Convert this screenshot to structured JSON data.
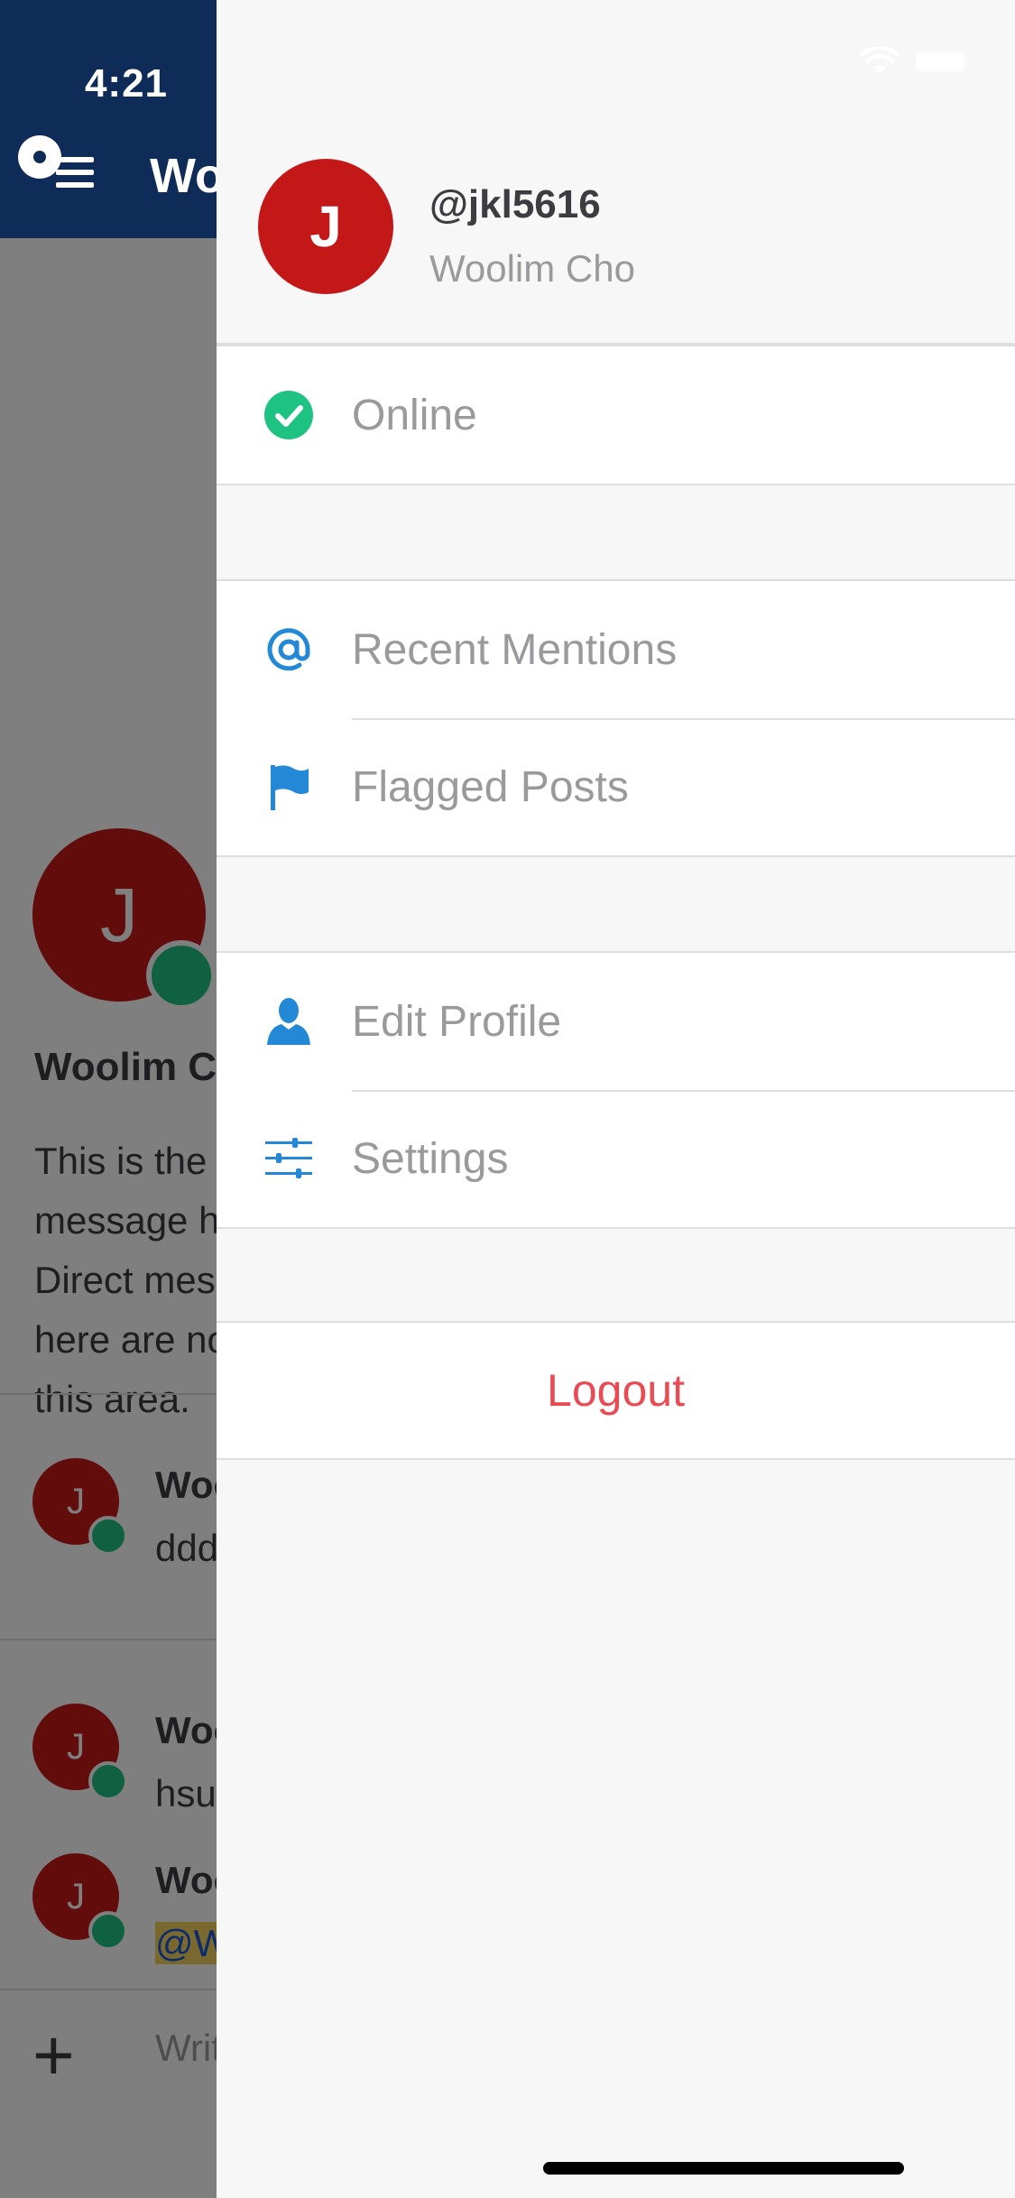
{
  "status_bar": {
    "time": "4:21"
  },
  "background": {
    "header_title": "Woolim Cho",
    "intro": {
      "avatar_initial": "J",
      "name": "Woolim Cho",
      "text": "This is the start of your direct message history with Woolim Cho. Direct messages and files shared here are not shown to people outside this area."
    },
    "posts": [
      {
        "avatar_initial": "J",
        "name": "Woolim Cho",
        "message": "ddd"
      },
      {
        "avatar_initial": "J",
        "name": "Woolim Cho",
        "message": "hsu"
      },
      {
        "avatar_initial": "J",
        "name": "Woolim Cho",
        "message": "@Woolim"
      }
    ],
    "input": {
      "placeholder": "Write to Woolim Cho"
    }
  },
  "drawer": {
    "profile": {
      "avatar_initial": "J",
      "username": "@jkl5616",
      "full_name": "Woolim Cho"
    },
    "status": {
      "label": "Online",
      "color": "#1ec282"
    },
    "menu_group_1": [
      {
        "label": "Recent Mentions",
        "icon": "at-icon"
      },
      {
        "label": "Flagged Posts",
        "icon": "flag-icon"
      }
    ],
    "menu_group_2": [
      {
        "label": "Edit Profile",
        "icon": "person-icon"
      },
      {
        "label": "Settings",
        "icon": "sliders-icon"
      }
    ],
    "logout": {
      "label": "Logout"
    }
  },
  "colors": {
    "accent_blue": "#2389d7",
    "logout_red": "#e94b55",
    "avatar_red": "#c41818",
    "header_navy": "#0f2b57",
    "online_green": "#1ec282"
  }
}
